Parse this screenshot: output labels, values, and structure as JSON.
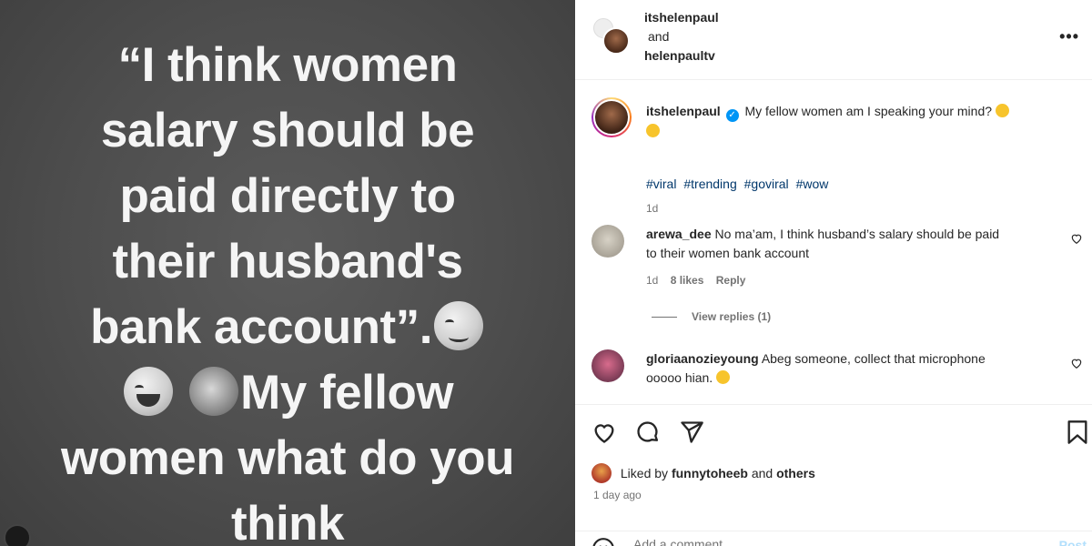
{
  "image": {
    "quote": {
      "line1": "“I think women",
      "line2": "salary should be",
      "line3": "paid directly to",
      "line4": "their husband's",
      "line5": "bank account”.",
      "line6_text": "My fellow",
      "line7": "women what do you",
      "line8": "think"
    },
    "emojis": [
      "relieved-face",
      "grinning-face",
      "woman-facepalming"
    ]
  },
  "header": {
    "user1": "itshelenpaul",
    "and_text": "and",
    "user2": "helenpaultv",
    "more_icon": "more-horizontal-icon"
  },
  "caption": {
    "username": "itshelenpaul",
    "verified_icon": "verified-badge-icon",
    "text": "My fellow women am I speaking your mind?",
    "emoji": "rolling-on-floor-laughing",
    "hashtags": [
      "#viral",
      "#trending",
      "#goviral",
      "#wow"
    ],
    "time": "1d"
  },
  "comments": [
    {
      "username": "arewa_dee",
      "text_line1": "No ma’am, I think husband’s salary should be paid",
      "text_line2": "to their women bank account",
      "time": "1d",
      "likes": "8 likes",
      "reply": "Reply",
      "view_replies": "View replies (1)"
    },
    {
      "username": "gloriaanozieyoung",
      "text_line1": "Abeg someone, collect that microphone",
      "text_line2": "ooooo hian.",
      "emoji": "laughing-face"
    }
  ],
  "actions": {
    "like_icon": "heart-icon",
    "comment_icon": "comment-icon",
    "share_icon": "send-icon",
    "save_icon": "bookmark-icon"
  },
  "likes": {
    "prefix": "Liked by",
    "user": "funnytoheeb",
    "and_text": "and",
    "others": "others",
    "time_ago": "1 day ago"
  },
  "add_comment": {
    "placeholder": "Add a comment…",
    "post_label": "Post",
    "emoji_icon": "smiley-icon"
  },
  "colors": {
    "link": "#00376b",
    "muted": "#737373",
    "verified": "#0095f6",
    "post_button_disabled": "#b2dffc"
  }
}
